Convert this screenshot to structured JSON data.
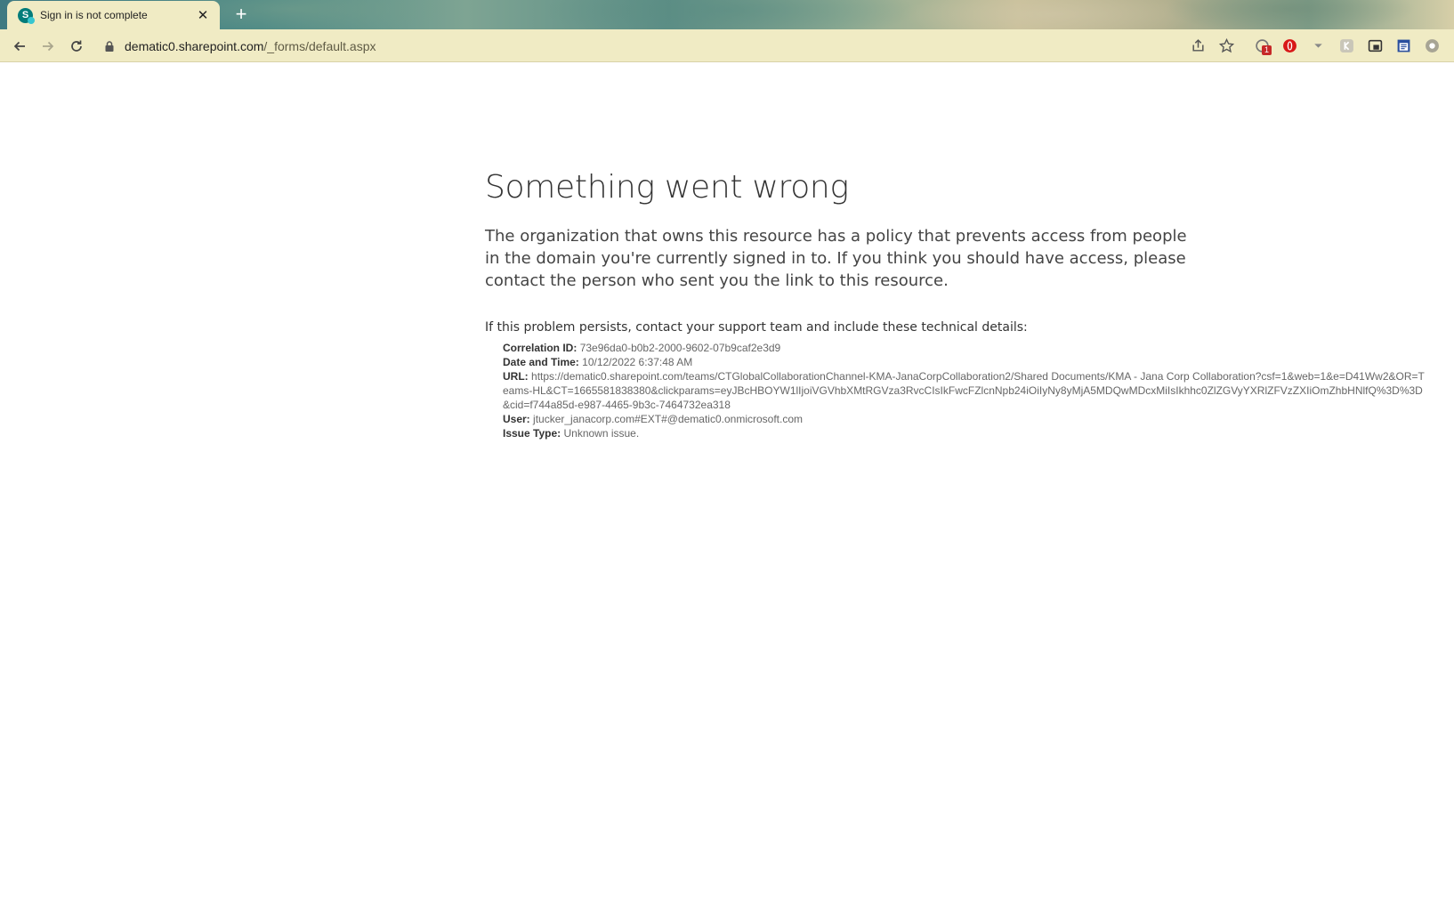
{
  "browser": {
    "tab": {
      "title": "Sign in is not complete",
      "favicon_letter": "S",
      "close_symbol": "✕"
    },
    "new_tab_symbol": "+",
    "address_bar": {
      "host": "dematic0.sharepoint.com",
      "path": "/_forms/default.aspx"
    },
    "extension_badge": "1",
    "icons": [
      "back-arrow-icon",
      "forward-arrow-icon",
      "reload-icon",
      "lock-icon",
      "share-icon",
      "star-bookmark-icon",
      "extension-icon",
      "opera-icon",
      "dropdown-arrow-icon",
      "extension-k-icon",
      "extension-window-icon",
      "extension-calendar-icon",
      "profile-icon"
    ]
  },
  "page": {
    "title": "Something went wrong",
    "message": "The organization that owns this resource has a policy that prevents access from people in the domain you're currently signed in to. If you think you should have access, please contact the person who sent you the link to this resource.",
    "problem_line": "If this problem persists, contact your support team and include these technical details:",
    "details": {
      "correlation_label": "Correlation ID:",
      "correlation_value": "73e96da0-b0b2-2000-9602-07b9caf2e3d9",
      "date_label": "Date and Time:",
      "date_value": "10/12/2022 6:37:48 AM",
      "url_label": "URL:",
      "url_value": "https://dematic0.sharepoint.com/teams/CTGlobalCollaborationChannel-KMA-JanaCorpCollaboration2/Shared Documents/KMA - Jana Corp Collaboration?csf=1&web=1&e=D41Ww2&OR=Teams-HL&CT=1665581838380&clickparams=eyJBcHBOYW1lIjoiVGVhbXMtRGVza3RvcCIsIkFwcFZlcnNpb24iOiIyNy8yMjA5MDQwMDcxMiIsIkhhc0ZlZGVyYXRlZFVzZXIiOmZhbHNlfQ%3D%3D&cid=f744a85d-e987-4465-9b3c-7464732ea318",
      "user_label": "User:",
      "user_value": "jtucker_janacorp.com#EXT#@dematic0.onmicrosoft.com",
      "issue_label": "Issue Type:",
      "issue_value": "Unknown issue."
    }
  },
  "colors": {
    "chrome_bar": "#f0ebc4",
    "sharepoint_teal": "#037c7a",
    "text_dark": "#333333",
    "text_muted": "#666666"
  }
}
